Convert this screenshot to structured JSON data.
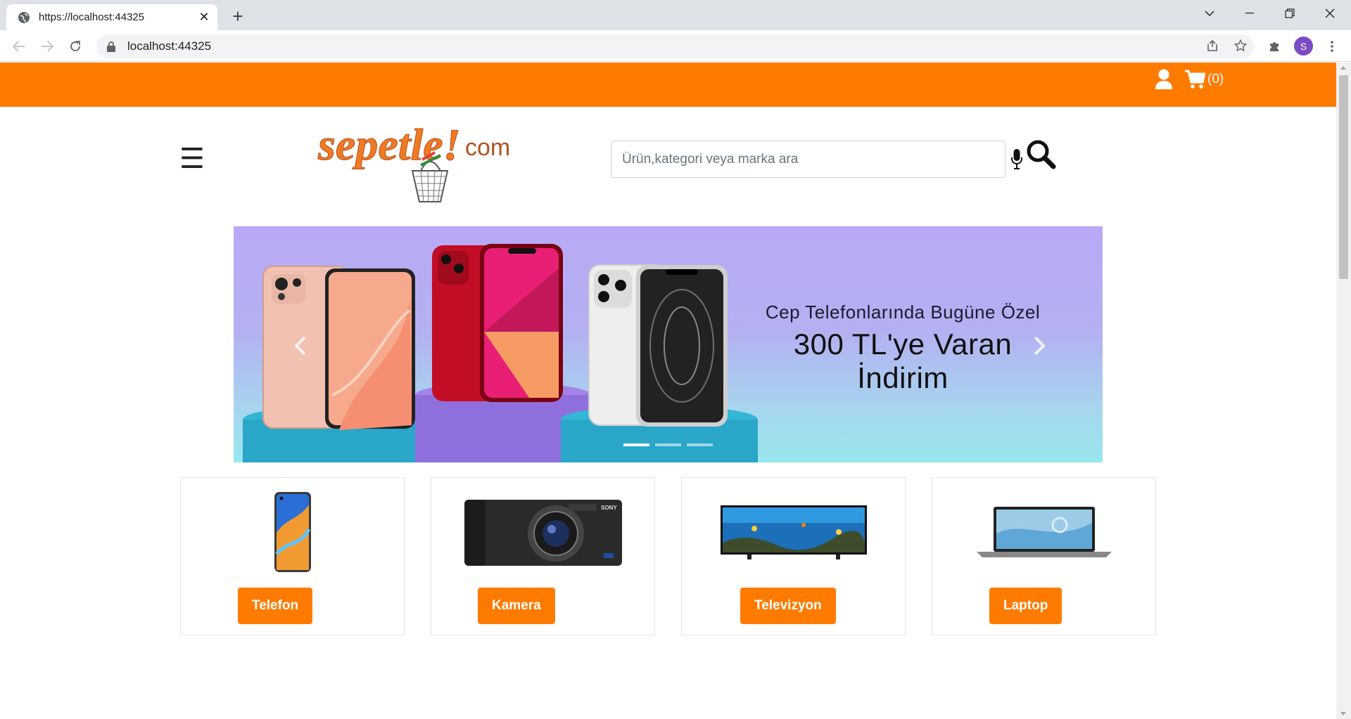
{
  "browser": {
    "tab_title": "https://localhost:44325",
    "url": "localhost:44325",
    "profile_initial": "S"
  },
  "header": {
    "cart_count": "(0)",
    "search_placeholder": "Ürün,kategori veya marka ara",
    "logo_text": "sepetle!com",
    "brand_color": "#ff7b00"
  },
  "banner": {
    "line1": "Cep Telefonlarında Bugüne Özel",
    "line2": "300 TL'ye Varan",
    "line3": "İndirim",
    "slides": 3,
    "active_slide": 1
  },
  "categories": [
    {
      "label": "Telefon",
      "icon": "phone-image"
    },
    {
      "label": "Kamera",
      "icon": "camera-image"
    },
    {
      "label": "Televizyon",
      "icon": "tv-image"
    },
    {
      "label": "Laptop",
      "icon": "laptop-image"
    }
  ]
}
